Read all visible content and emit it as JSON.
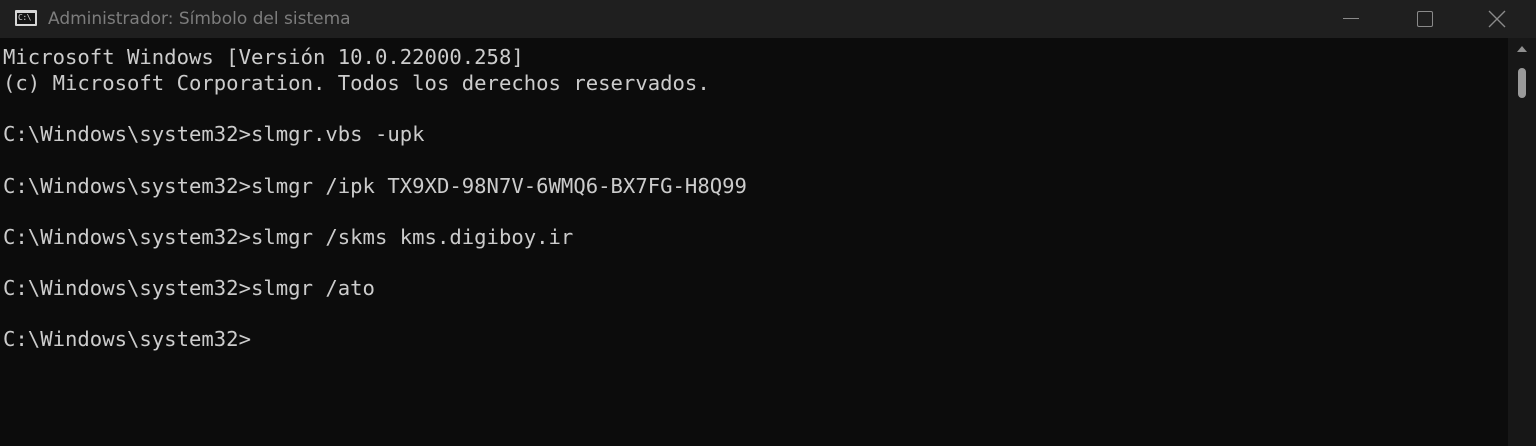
{
  "window": {
    "title": "Administrador: Símbolo del sistema",
    "app_icon": "terminal-icon",
    "app_icon_glyph": "C:\\",
    "controls": {
      "minimize": "minimize-icon",
      "maximize": "maximize-icon",
      "close": "close-icon"
    }
  },
  "console": {
    "lines": [
      "Microsoft Windows [Versión 10.0.22000.258]",
      "(c) Microsoft Corporation. Todos los derechos reservados.",
      "",
      "C:\\Windows\\system32>slmgr.vbs -upk",
      "",
      "C:\\Windows\\system32>slmgr /ipk TX9XD-98N7V-6WMQ6-BX7FG-H8Q99",
      "",
      "C:\\Windows\\system32>slmgr /skms kms.digiboy.ir",
      "",
      "C:\\Windows\\system32>slmgr /ato",
      "",
      "C:\\Windows\\system32>"
    ]
  },
  "colors": {
    "background": "#0c0c0c",
    "text": "#cccccc",
    "titlebar": "#1f1f1f"
  }
}
